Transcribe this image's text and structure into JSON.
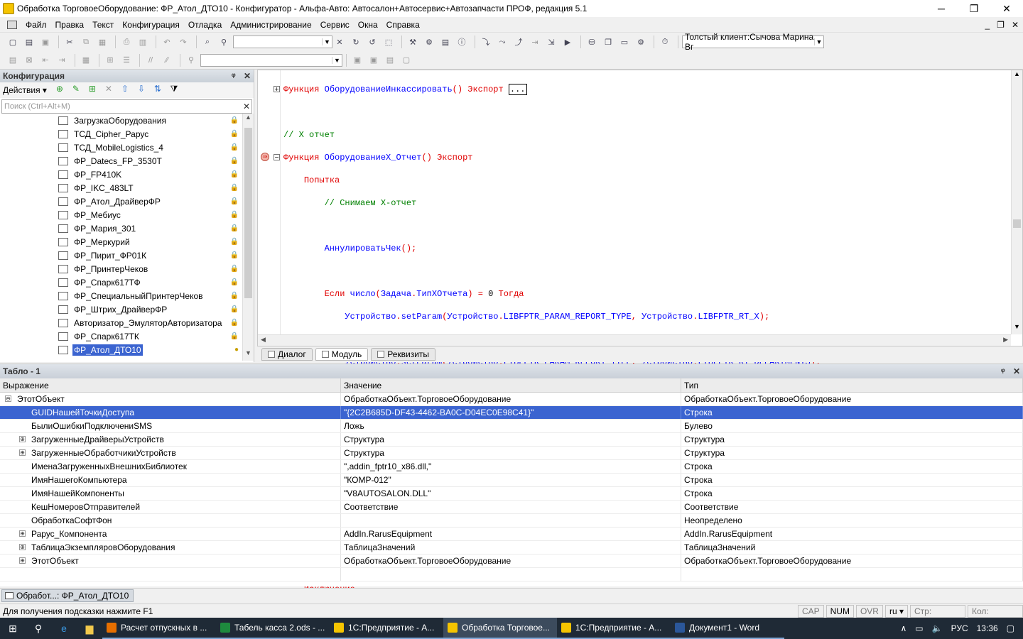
{
  "window": {
    "title": "Обработка ТорговоеОборудование: ФР_Атол_ДТО10 - Конфигуратор - Альфа-Авто: Автосалон+Автосервис+Автозапчасти ПРОФ, редакция 5.1",
    "minimize": "─",
    "maximize": "❐",
    "close": "✕"
  },
  "menu": {
    "items": [
      "Файл",
      "Правка",
      "Текст",
      "Конфигурация",
      "Отладка",
      "Администрирование",
      "Сервис",
      "Окна",
      "Справка"
    ],
    "mdi_minimize": "_",
    "mdi_restore": "❐",
    "mdi_close": "✕"
  },
  "toolbar": {
    "user_session": "Толстый клиент:Сычова Марина Вг"
  },
  "config_panel": {
    "title": "Конфигурация",
    "pin": "ᵠ",
    "close": "✕",
    "actions_label": "Действия ▾",
    "search_placeholder": "Поиск (Ctrl+Alt+M)",
    "tree_items": [
      "ЗагрузкаОборудования",
      "ТСД_Cipher_Рарус",
      "ТСД_MobileLogistics_4",
      "ФР_Datecs_FP_3530T",
      "ФР_FP410K",
      "ФР_IKC_483LT",
      "ФР_Атол_ДрайверФР",
      "ФР_Мебиус",
      "ФР_Мария_301",
      "ФР_Меркурий",
      "ФР_Пирит_ФР01К",
      "ФР_ПринтерЧеков",
      "ФР_Спарк617ТФ",
      "ФР_СпециальныйПринтерЧеков",
      "ФР_Штрих_ДрайверФР",
      "Авторизатор_ЭмуляторАвторизатора",
      "ФР_Спарк617ТК",
      "ФР_Атол_ДТО10"
    ],
    "selected_index": 17
  },
  "editor": {
    "tabs": [
      "Диалог",
      "Модуль",
      "Реквизиты"
    ],
    "active_tab": 1
  },
  "watch": {
    "title": "Табло - 1",
    "pin": "ᵠ",
    "close": "✕",
    "columns": [
      "Выражение",
      "Значение",
      "Тип"
    ],
    "rows": [
      {
        "expr": "ЭтотОбъект",
        "value": "ОбработкаОбъект.ТорговоеОборудование",
        "type": "ОбработкаОбъект.ТорговоеОборудование",
        "level": 0,
        "exp": "⊖"
      },
      {
        "expr": "GUIDНашейТочкиДоступа",
        "value": "\"{2C2B685D-DF43-4462-BA0C-D04EC0E98C41}\"",
        "type": "Строка",
        "level": 1,
        "exp": ""
      },
      {
        "expr": "БылиОшибкиПодключениSMS",
        "value": "Ложь",
        "type": "Булево",
        "level": 1,
        "exp": ""
      },
      {
        "expr": "ЗагруженныеДрайверыУстройств",
        "value": "Структура",
        "type": "Структура",
        "level": 1,
        "exp": "⊕"
      },
      {
        "expr": "ЗагруженныеОбработчикиУстройств",
        "value": "Структура",
        "type": "Структура",
        "level": 1,
        "exp": "⊕"
      },
      {
        "expr": "ИменаЗагруженныхВнешнихБиблиотек",
        "value": "\",addin_fptr10_x86.dll,\"",
        "type": "Строка",
        "level": 1,
        "exp": ""
      },
      {
        "expr": "ИмяНашегоКомпьютера",
        "value": "\"КОМР-012\"",
        "type": "Строка",
        "level": 1,
        "exp": ""
      },
      {
        "expr": "ИмяНашейКомпоненты",
        "value": "\"V8AUTOSALON.DLL\"",
        "type": "Строка",
        "level": 1,
        "exp": ""
      },
      {
        "expr": "КешНомеровОтправителей",
        "value": "Соответствие",
        "type": "Соответствие",
        "level": 1,
        "exp": ""
      },
      {
        "expr": "ОбработкаСофтФон",
        "value": "",
        "type": "Неопределено",
        "level": 1,
        "exp": ""
      },
      {
        "expr": "Рарус_Компонента",
        "value": "AddIn.RarusEquipment",
        "type": "AddIn.RarusEquipment",
        "level": 1,
        "exp": "⊕"
      },
      {
        "expr": "ТаблицаЭкземпляровОборудования",
        "value": "ТаблицаЗначений",
        "type": "ТаблицаЗначений",
        "level": 1,
        "exp": "⊕"
      },
      {
        "expr": "ЭтотОбъект",
        "value": "ОбработкаОбъект.ТорговоеОборудование",
        "type": "ОбработкаОбъект.ТорговоеОборудование",
        "level": 1,
        "exp": "⊕"
      }
    ],
    "selected_index": 1
  },
  "window_tab": "Обработ...: ФР_Атол_ДТО10",
  "status": {
    "hint": "Для получения подсказки нажмите F1",
    "cap": "CAP",
    "num": "NUM",
    "ovr": "OVR",
    "lang": "ru ▾",
    "line": "Стр:",
    "col": "Кол:"
  },
  "taskbar": {
    "apps": [
      {
        "label": "Расчет отпускных в ...",
        "color": "#e76f00"
      },
      {
        "label": "Табель касса 2.ods - ...",
        "color": "#1e8a3e"
      },
      {
        "label": "1С:Предприятие - А...",
        "color": "#f5c400"
      },
      {
        "label": "Обработка Торговое...",
        "color": "#f5c400"
      },
      {
        "label": "1С:Предприятие - А...",
        "color": "#f5c400"
      },
      {
        "label": "Документ1 - Word",
        "color": "#2b579a"
      }
    ],
    "active_index": 3,
    "lang": "РУС",
    "time": "13:36"
  }
}
